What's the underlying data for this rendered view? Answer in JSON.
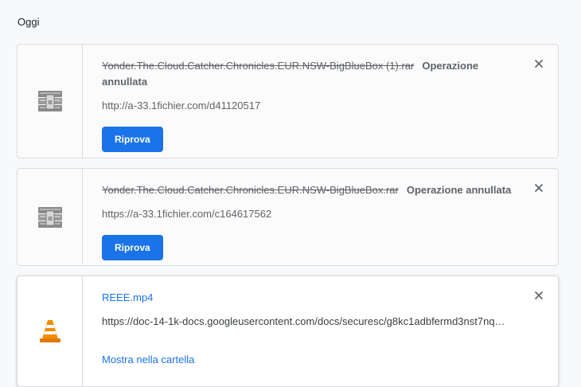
{
  "section": {
    "date_label": "Oggi"
  },
  "downloads": [
    {
      "filename": "Yonder.The.Cloud.Catcher.Chronicles.EUR.NSW-BigBlueBox (1).rar",
      "status": "Operazione annullata",
      "url": "http://a-33.1fichier.com/d41120517",
      "action_label": "Riprova",
      "icon": "winrar-archive-icon"
    },
    {
      "filename": "Yonder.The.Cloud.Catcher.Chronicles.EUR.NSW-BigBlueBox.rar",
      "status": "Operazione annullata",
      "url": "https://a-33.1fichier.com/c164617562",
      "action_label": "Riprova",
      "icon": "winrar-archive-icon"
    },
    {
      "filename": "REEE.mp4",
      "url": "https://doc-14-1k-docs.googleusercontent.com/docs/securesc/g8kc1adbfermd3nst7nq…",
      "action_label": "Mostra nella cartella",
      "icon": "vlc-cone-icon"
    }
  ],
  "colors": {
    "accent": "#1a73e8",
    "muted_text": "#5f6368",
    "border": "#dadce0"
  }
}
